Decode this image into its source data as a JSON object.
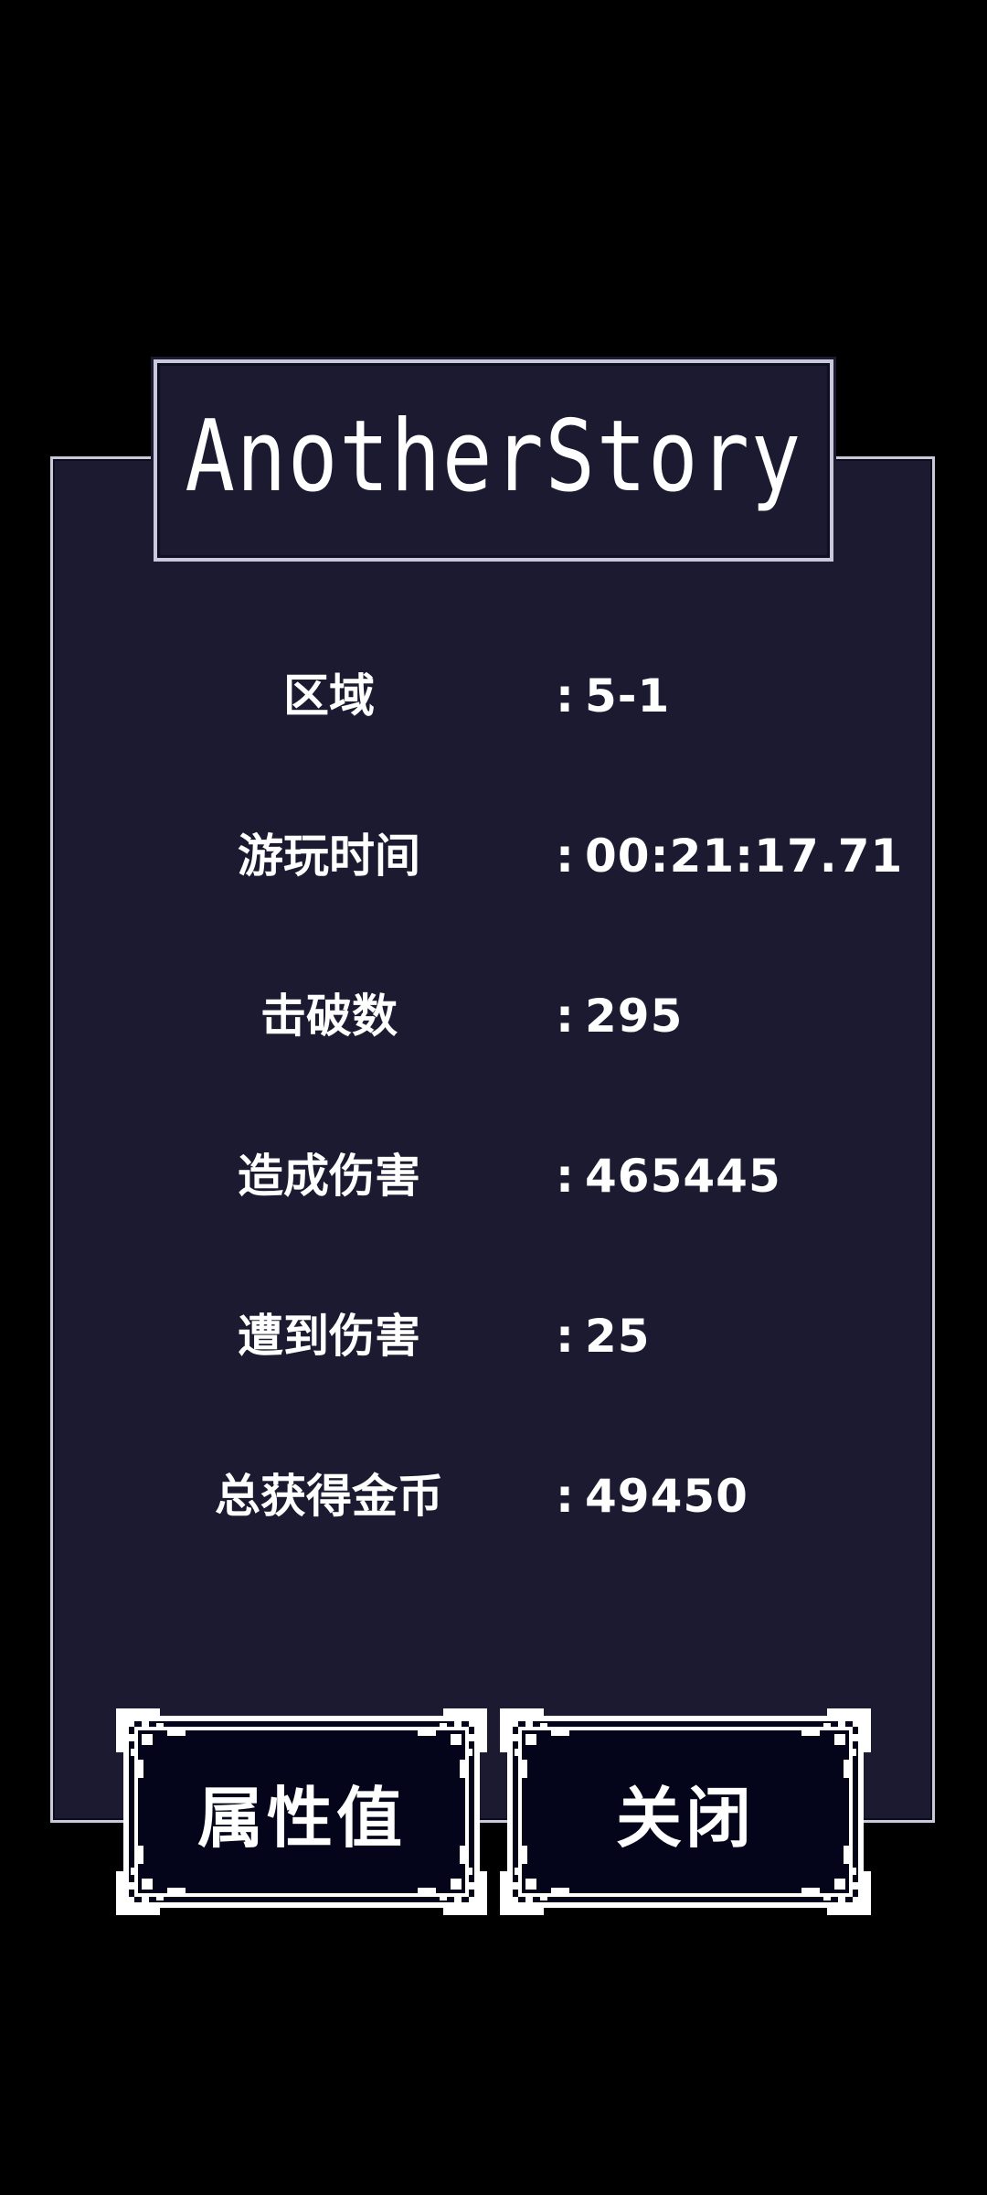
{
  "game": {
    "title": "AnotherStory"
  },
  "stats": [
    {
      "label": "区域",
      "colon": ":",
      "value": "5-1"
    },
    {
      "label": "游玩时间",
      "colon": ":",
      "value": "00:21:17.71"
    },
    {
      "label": "击破数",
      "colon": ":",
      "value": "295"
    },
    {
      "label": "造成伤害",
      "colon": ":",
      "value": "465445"
    },
    {
      "label": "遭到伤害",
      "colon": ":",
      "value": "25"
    },
    {
      "label": "总获得金币",
      "colon": ":",
      "value": "49450"
    }
  ],
  "buttons": {
    "attributes_label": "属性值",
    "close_label": "关闭"
  },
  "colors": {
    "background": "#000000",
    "panel": "#1b1a30",
    "border": "#c9c9de",
    "button_fill": "#04051a",
    "text": "#ffffff"
  }
}
